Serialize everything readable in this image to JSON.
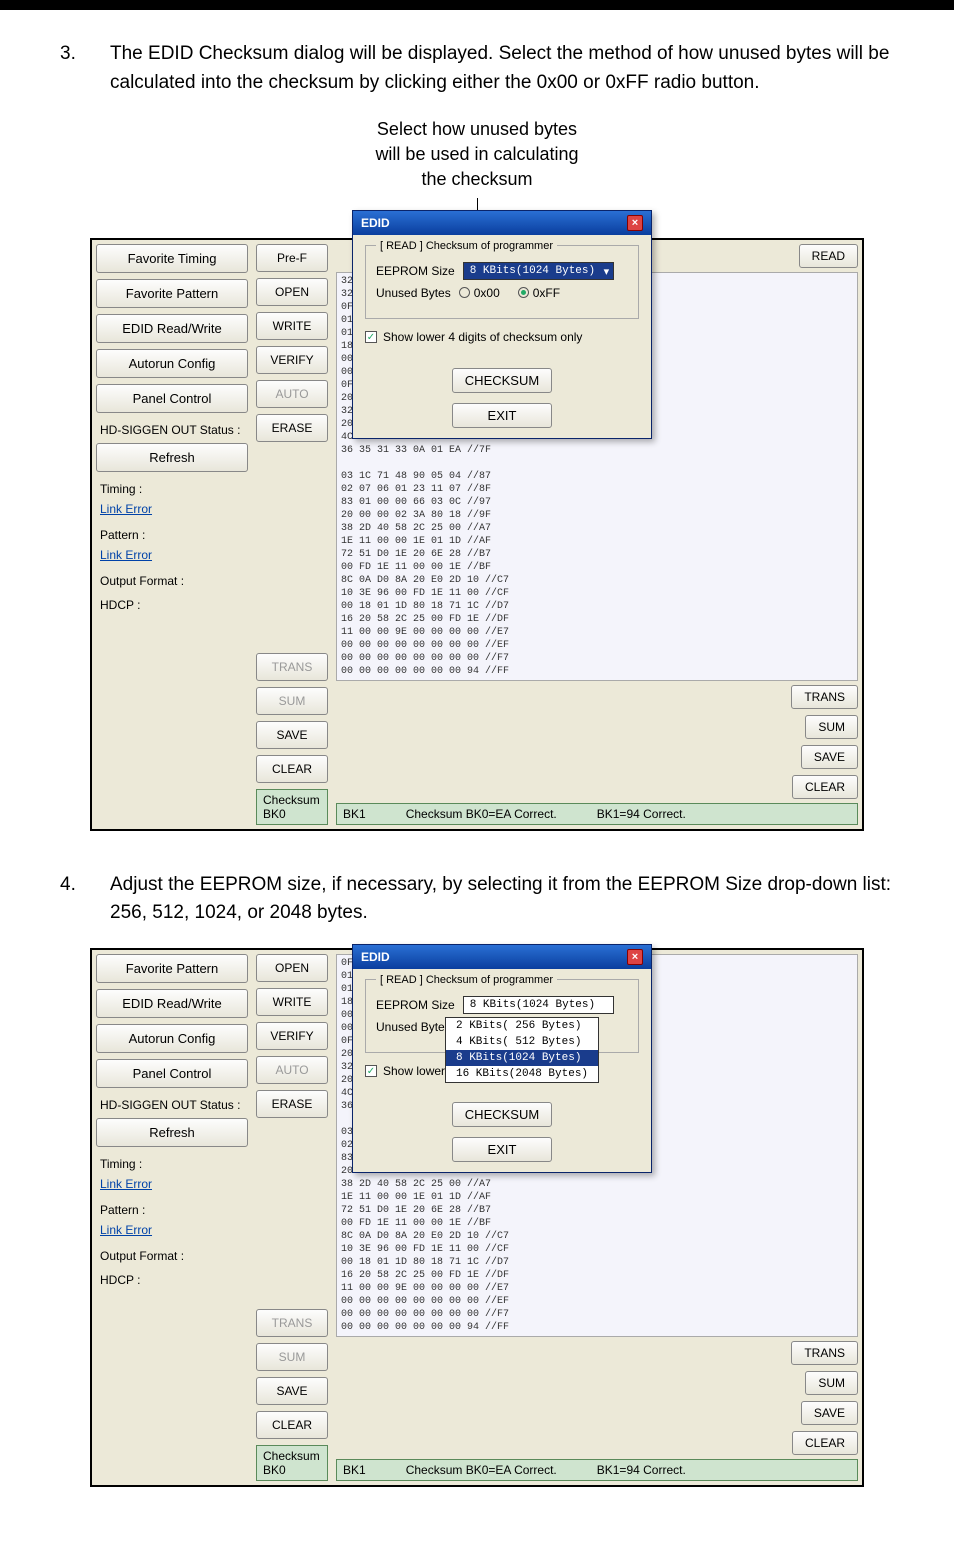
{
  "step3_num": "3.",
  "step3_text": "The EDID Checksum dialog will be displayed.  Select the method of how unused bytes will be calculated into the checksum by clicking either the 0x00 or 0xFF radio button.",
  "caption1_l1": "Select how unused bytes",
  "caption1_l2": "will be used in calculating",
  "caption1_l3": "the checksum",
  "step4_num": "4.",
  "step4_text": "Adjust the EEPROM size, if necessary, by selecting it from the EEPROM Size drop-down list:  256, 512, 1024, or 2048 bytes.",
  "side": {
    "fav_timing": "Favorite Timing",
    "fav_pattern": "Favorite Pattern",
    "edid_rw": "EDID Read/Write",
    "autorun": "Autorun Config",
    "panel_ctrl": "Panel Control",
    "hd_siggen": "HD-SIGGEN OUT Status :",
    "refresh": "Refresh",
    "timing": "Timing :",
    "link_error1": "Link Error",
    "pattern": "Pattern :",
    "link_error2": "Link Error",
    "output_fmt": "Output Format :",
    "hdcp": "HDCP :"
  },
  "mid": {
    "pref": "Pre-F",
    "open": "OPEN",
    "write": "WRITE",
    "verify": "VERIFY",
    "auto": "AUTO",
    "erase": "ERASE",
    "trans": "TRANS",
    "sum": "SUM",
    "save": "SAVE",
    "clear": "CLEAR"
  },
  "right": {
    "read": "READ",
    "trans": "TRANS",
    "sum": "SUM",
    "save": "SAVE",
    "clear": "CLEAR"
  },
  "status": {
    "bk0": "Checksum BK0",
    "bk1": "BK1",
    "bk0_correct": "Checksum BK0=EA Correct.",
    "bk1_correct": "BK1=94 Correct."
  },
  "dialog": {
    "title": "EDID",
    "legend": "[ READ ] Checksum of programmer",
    "size_label": "EEPROM Size",
    "size_value": "8 KBits(1024 Bytes)",
    "unused_label": "Unused Bytes",
    "radio_0x00": "0x00",
    "radio_0xff": "0xFF",
    "show_lower": "Show lower 4 digits of checksum only",
    "checksum": "CHECKSUM",
    "exit": "EXIT",
    "dd_opt1": "8 KBits(1024 Bytes)",
    "dd_opt2": "2 KBits( 256 Bytes)",
    "dd_opt3": "4 KBits( 512 Bytes)",
    "dd_opt4": "8 KBits(1024 Bytes)",
    "dd_opt5": "16 KBits(2048 Bytes)",
    "show_lower_short": "Show lower"
  },
  "hex_block": "32 13 01 03 80 33 1D 78 //17\n32 90 A8 A3 58 53 9F 26 //1F\n0F 50 54 25 CE 00 01 01 //27\n01 01 01 01 01 01 01 01 //2F\n01 01 01 01 01 02 3A //37\n18 71 38 2D 40 58 2C //3F\n00 FD 1E 11 00 00 1E //47\n00 00 FD 00 38 4C 1F //4F\n0F 00 0A 20 20 20 20 //57\n20 00 00 00 FC 00 56 //5F\n32 33 30 58 56 54 0A //67\n20 20 20 00 00 00 FF //6F\n4C 49 49 49 47 43 41 //77\n36 35 31 33 0A 01 EA //7F\n\n03 1C 71 48 90 05 04 //87\n02 07 06 01 23 11 07 //8F\n83 01 00 00 66 03 0C //97\n20 00 00 02 3A 80 18 //9F\n38 2D 40 58 2C 25 00 //A7\n1E 11 00 00 1E 01 1D //AF\n72 51 D0 1E 20 6E 28 //B7\n00 FD 1E 11 00 00 1E //BF\n8C 0A D0 8A 20 E0 2D 10 //C7\n10 3E 96 00 FD 1E 11 00 //CF\n00 18 01 1D 80 18 71 1C //D7\n16 20 58 2C 25 00 FD 1E //DF\n11 00 00 9E 00 00 00 00 //E7\n00 00 00 00 00 00 00 00 //EF\n00 00 00 00 00 00 00 00 //F7\n00 00 00 00 00 00 00 94 //FF",
  "hex_block2": "0F 50 54 25 CE 00 01 01 //27\n01 01 01 01 01 01 01 01 //2F\n01 01 01 01 01 02 3A //37\n18 71 38 2D 40 58 2C //3F\n00 FD 1E 11 00 00 1E //47\n00 00 FD 00 38 4C 1F //4F\n0F 00 0A 20 20 20 20 //57\n20 00 00 00 FC 00 56 //5F\n32 33 30 58 56 54 0A //67\n20 20 20 00 00 00 FF //6F\n4C 49 49 49 47 43 41 //77\n36 35 31 33 0A 01 EA //7F\n\n03 1C 71 48 90 05 04 //87\n02 07 06 01 23 11 07 //8F\n83 01 00 00 66 03 0C //97\n20 00 00 02 3A 80 18 //9F\n38 2D 40 58 2C 25 00 //A7\n1E 11 00 00 1E 01 1D //AF\n72 51 D0 1E 20 6E 28 //B7\n00 FD 1E 11 00 00 1E //BF\n8C 0A D0 8A 20 E0 2D 10 //C7\n10 3E 96 00 FD 1E 11 00 //CF\n00 18 01 1D 80 18 71 1C //D7\n16 20 58 2C 25 00 FD 1E //DF\n11 00 00 9E 00 00 00 00 //E7\n00 00 00 00 00 00 00 00 //EF\n00 00 00 00 00 00 00 00 //F7\n00 00 00 00 00 00 00 94 //FF"
}
